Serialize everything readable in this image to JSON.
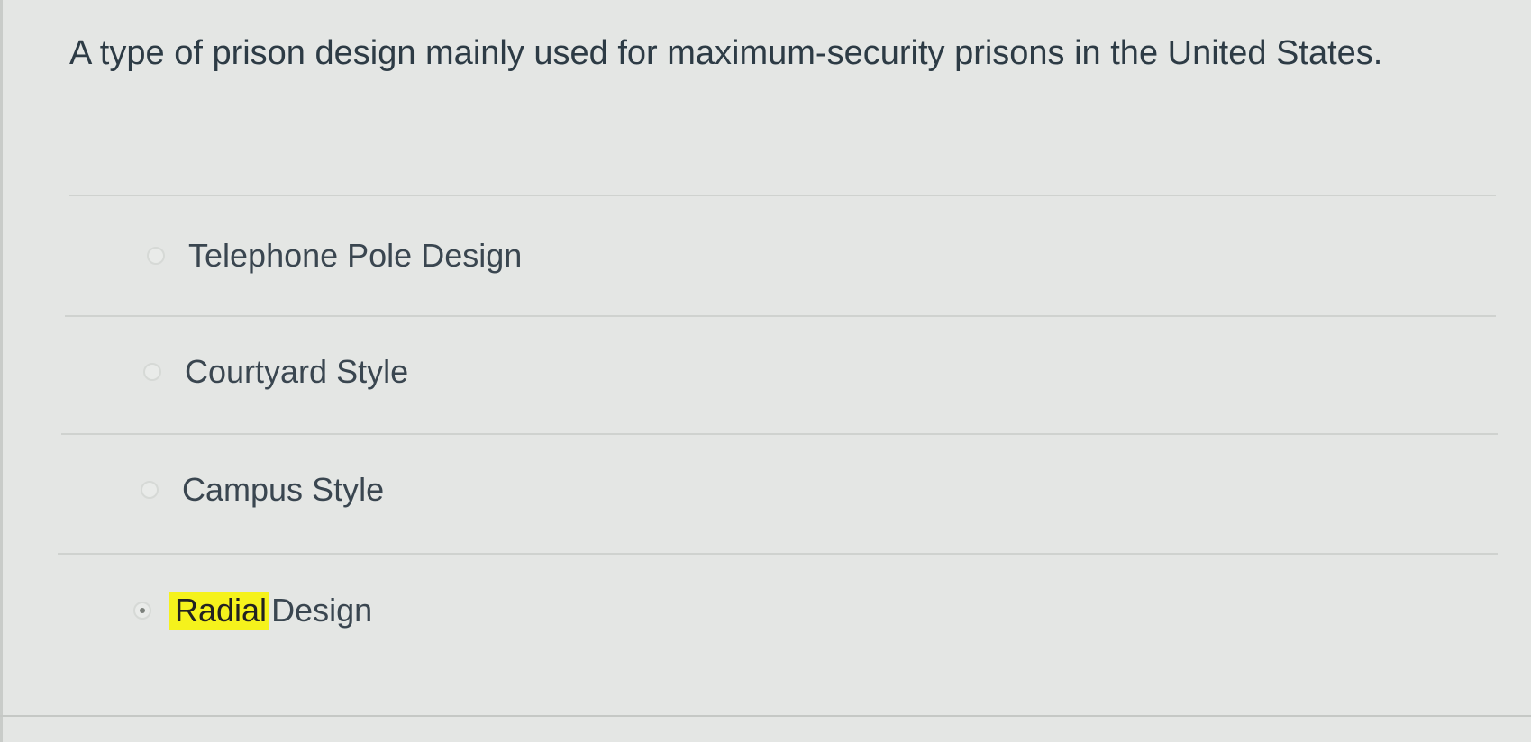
{
  "question": {
    "text": "A type of prison design mainly used for maximum-security prisons in the United States."
  },
  "answers": [
    {
      "label": "Telephone Pole Design",
      "selected": false
    },
    {
      "label": "Courtyard Style",
      "selected": false
    },
    {
      "label": "Campus Style",
      "selected": false
    },
    {
      "label_highlighted": "Radial",
      "label_rest": "Design",
      "selected": true
    }
  ],
  "colors": {
    "background": "#e4e6e4",
    "text": "#2d3b45",
    "highlight": "#f5f21c"
  }
}
